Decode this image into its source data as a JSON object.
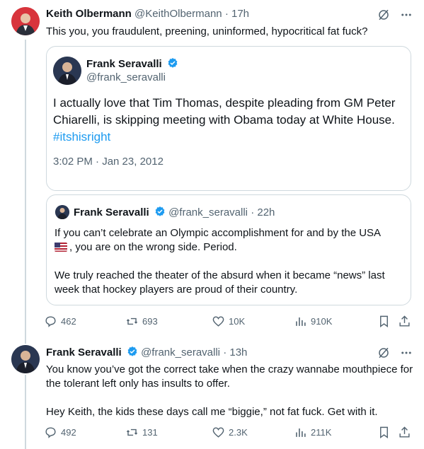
{
  "colors": {
    "accent": "#1d9bf0",
    "secondary_text": "#536471",
    "border": "#cfd9de"
  },
  "tweet1": {
    "name": "Keith Olbermann",
    "handle": "@KeithOlbermann",
    "time": "· 17h",
    "text": "This you, you fraudulent, preening, uninformed, hypocritical fat fuck?",
    "quoted": {
      "name": "Frank Seravalli",
      "handle": "@frank_seravalli",
      "text": "I actually love that Tim Thomas, despite pleading from GM Peter Chiarelli, is skipping meeting with Obama today at White House.",
      "hashtag": "#itshisright",
      "timestamp": "3:02 PM · Jan 23, 2012"
    },
    "quoted2": {
      "name": "Frank Seravalli",
      "handle": "@frank_seravalli",
      "time": "· 22h",
      "line1": "If you can’t celebrate an Olympic accomplishment for and by the USA",
      "line2": ", you are on the wrong side. Period.",
      "para2": "We truly reached the theater of the absurd when it became “news” last week that hockey players are proud of their country."
    },
    "stats": {
      "replies": "462",
      "reposts": "693",
      "likes": "10K",
      "views": "910K"
    }
  },
  "tweet2": {
    "name": "Frank Seravalli",
    "handle": "@frank_seravalli",
    "time": "· 13h",
    "text1": "You know you’ve got the correct take when the crazy wannabe mouthpiece for the tolerant left only has insults to offer.",
    "text2": "Hey Keith, the kids these days call me “biggie,” not fat fuck. Get with it.",
    "stats": {
      "replies": "492",
      "reposts": "131",
      "likes": "2.3K",
      "views": "211K"
    }
  }
}
